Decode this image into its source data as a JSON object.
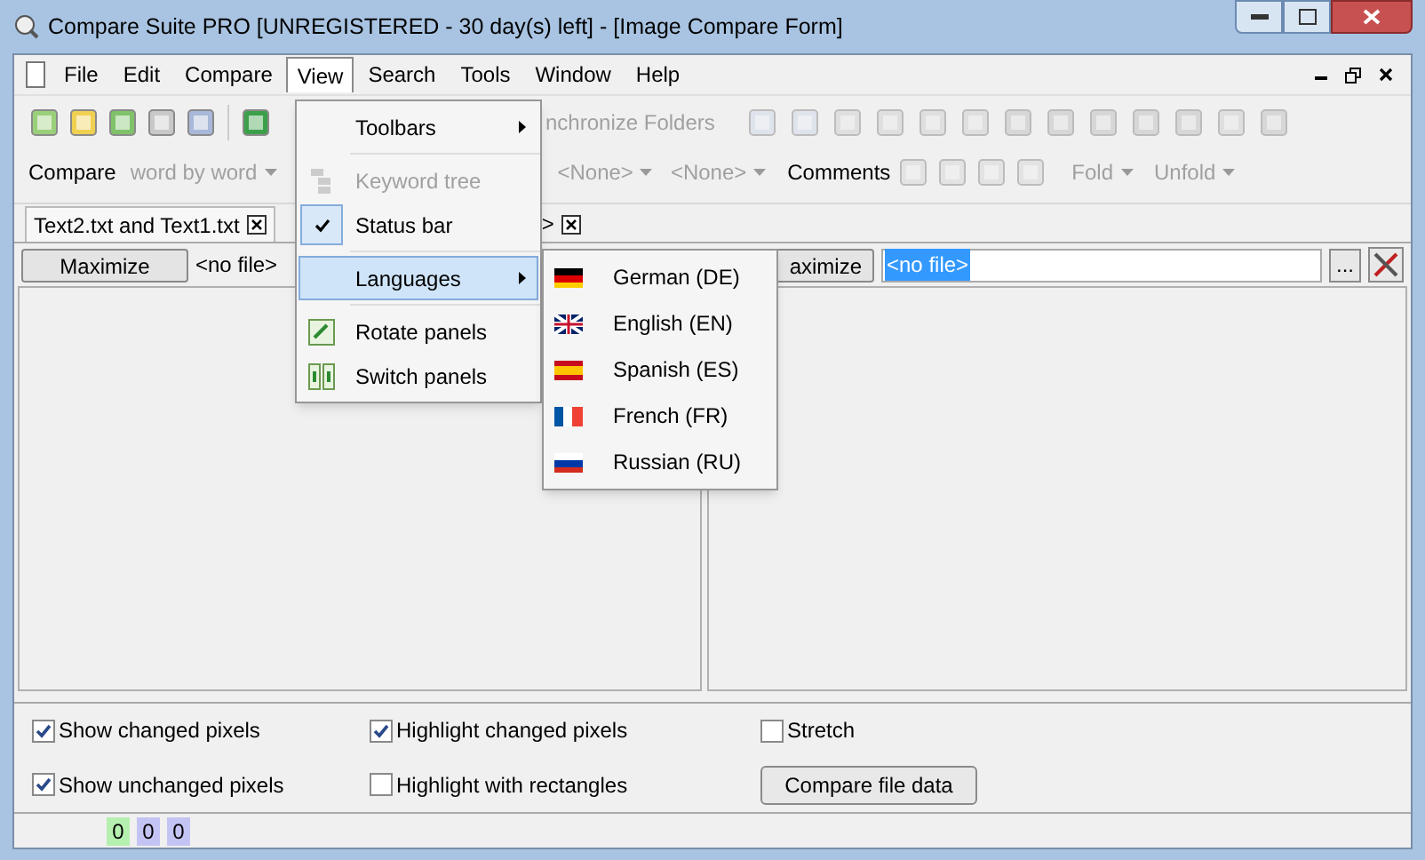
{
  "window": {
    "title": "Compare Suite PRO [UNREGISTERED - 30 day(s) left] - [Image Compare Form]"
  },
  "menu_bar": [
    {
      "label": "File",
      "selected": false
    },
    {
      "label": "Edit",
      "selected": false
    },
    {
      "label": "Compare",
      "selected": false
    },
    {
      "label": "View",
      "selected": true
    },
    {
      "label": "Search",
      "selected": false
    },
    {
      "label": "Tools",
      "selected": false
    },
    {
      "label": "Window",
      "selected": false
    },
    {
      "label": "Help",
      "selected": false
    }
  ],
  "toolbar_1": {
    "label": "nchronize Folders"
  },
  "toolbar_2": {
    "compare_label": "Compare",
    "mode": "word by word",
    "filters": [
      "<None>",
      "<None>"
    ],
    "comments_label": "Comments",
    "fold": "Fold",
    "unfold": "Unfold"
  },
  "tabs": [
    {
      "label": "Text2.txt and Text1.txt",
      "selected": true
    },
    {
      "label": ">",
      "selected": false
    }
  ],
  "left_panel": {
    "button": "Maximize",
    "file": "<no file>"
  },
  "right_panel": {
    "button": "aximize",
    "file": "<no file>",
    "browse": "..."
  },
  "options": [
    {
      "kind": "checkbox",
      "label": "Show changed pixels",
      "checked": true
    },
    {
      "kind": "checkbox",
      "label": "Highlight changed pixels",
      "checked": true
    },
    {
      "kind": "checkbox",
      "label": "Stretch",
      "checked": false
    },
    {
      "kind": "checkbox",
      "label": "Show unchanged pixels",
      "checked": true
    },
    {
      "kind": "checkbox",
      "label": "Highlight with rectangles",
      "checked": false
    },
    {
      "kind": "button",
      "label": "Compare file data"
    }
  ],
  "status_bar": [
    {
      "text": "0",
      "color": "#b6f0b0"
    },
    {
      "text": "0",
      "color": "#c4c4f4"
    },
    {
      "text": "0",
      "color": "#c4c4f4"
    }
  ],
  "view_menu": [
    {
      "kind": "submenu",
      "label": "Toolbars",
      "selected": false,
      "disabled": false,
      "checked": false
    },
    {
      "kind": "separator"
    },
    {
      "kind": "item",
      "label": "Keyword tree",
      "selected": false,
      "disabled": true,
      "checked": false
    },
    {
      "kind": "item",
      "label": "Status bar",
      "selected": false,
      "disabled": false,
      "checked": true
    },
    {
      "kind": "separator"
    },
    {
      "kind": "submenu",
      "label": "Languages",
      "selected": true,
      "disabled": false,
      "checked": false
    },
    {
      "kind": "separator"
    },
    {
      "kind": "item",
      "label": "Rotate panels",
      "selected": false,
      "disabled": false,
      "checked": false
    },
    {
      "kind": "item",
      "label": "Switch panels",
      "selected": false,
      "disabled": false,
      "checked": false
    }
  ],
  "languages_menu": [
    {
      "label": "German (DE)",
      "kind": "de"
    },
    {
      "label": "English (EN)",
      "kind": "en"
    },
    {
      "label": "Spanish (ES)",
      "kind": "es"
    },
    {
      "label": "French (FR)",
      "kind": "fr"
    },
    {
      "label": "Russian (RU)",
      "kind": "ru"
    }
  ]
}
